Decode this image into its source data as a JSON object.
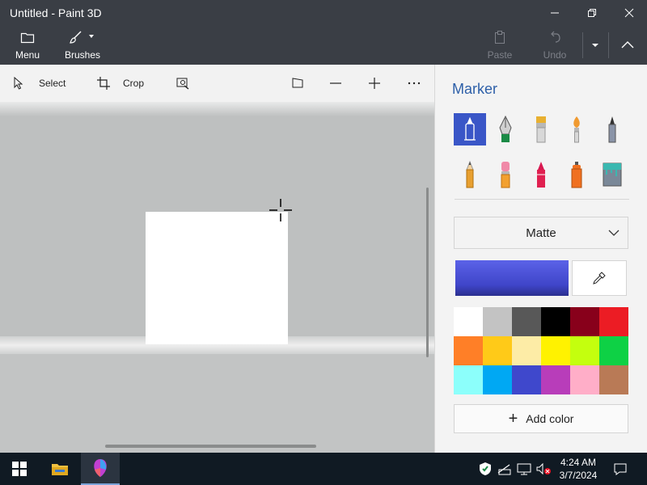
{
  "window": {
    "title": "Untitled - Paint 3D",
    "controls": [
      "minimize-icon",
      "restore-icon",
      "close-icon"
    ]
  },
  "ribbon": {
    "menu_label": "Menu",
    "brushes_label": "Brushes",
    "paste_label": "Paste",
    "undo_label": "Undo"
  },
  "toolbar": {
    "select_label": "Select",
    "crop_label": "Crop"
  },
  "panel": {
    "title": "Marker",
    "brushes": [
      "marker",
      "calligraphy-pen",
      "oil-brush",
      "watercolor",
      "pixel-pen",
      "pencil",
      "eraser",
      "crayon",
      "spray-can",
      "fill"
    ],
    "selected_brush": "marker",
    "finish": "Matte",
    "current_color": "#3f45c9",
    "palette": [
      "#ffffff",
      "#c3c3c3",
      "#585858",
      "#000000",
      "#88001b",
      "#ec1c24",
      "#ff7f27",
      "#ffca18",
      "#fdeca6",
      "#fff200",
      "#c4ff0e",
      "#0ed145",
      "#8cfffb",
      "#00a8f3",
      "#3f48cc",
      "#b83dba",
      "#ffaec8",
      "#b97a56"
    ],
    "add_color_label": "Add color"
  },
  "taskbar": {
    "time": "4:24 AM",
    "date": "3/7/2024"
  }
}
